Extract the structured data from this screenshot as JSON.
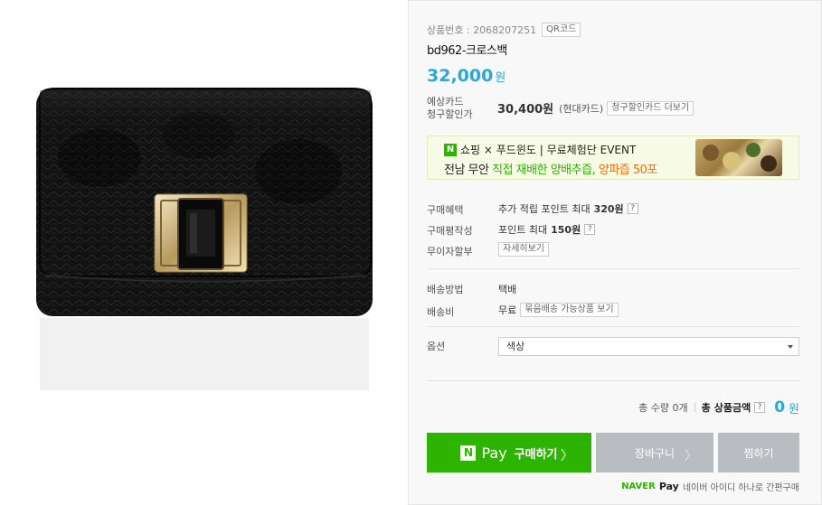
{
  "product": {
    "number_label": "상품번호 : 2068207251",
    "qr_label": "QR코드",
    "name": "bd962-크로스백",
    "price": "32,000",
    "price_unit": "원"
  },
  "card": {
    "label": "예상카드\n청구할인가",
    "price": "30,400원",
    "card_name": "(현대카드)",
    "more_label": "청구할인카드 더보기"
  },
  "banner": {
    "line1": "쇼핑 × 푸드윈도 | 무료체험단 EVENT",
    "line2_a": "전남 무안",
    "line2_b": "직접 재배한 양배추즙,",
    "line2_c": "양파즙 50포"
  },
  "benefits": {
    "purchase_benefit_label": "구매혜택",
    "purchase_benefit_value_a": "추가 적립 포인트 최대",
    "purchase_benefit_value_b": "320원",
    "review_label": "구매평작성",
    "review_value_a": "포인트 최대",
    "review_value_b": "150원",
    "installment_label": "무이자할부",
    "installment_btn": "자세히보기"
  },
  "shipping": {
    "method_label": "배송방법",
    "method_value": "택배",
    "fee_label": "배송비",
    "fee_value": "무료",
    "bundle_btn": "묶음배송 가능상품 보기"
  },
  "option": {
    "label": "옵션",
    "select_value": "색상"
  },
  "total": {
    "qty_label": "총 수량 0개",
    "total_prefix": "총",
    "total_label": "상품금액",
    "amount": "0",
    "amount_unit": "원"
  },
  "buttons": {
    "pay_n": "N",
    "pay": "Pay",
    "buy": "구매하기",
    "cart": "장바구니",
    "wish": "찜하기"
  },
  "footer": {
    "naver": "NAVER",
    "pay": "Pay",
    "text": "네이버 아이디 하나로 간편구매"
  },
  "help_mark": "?",
  "colors": {
    "accent_blue": "#2aa8d8",
    "naver_green": "#2db400",
    "gray_button": "#b9bcc1"
  }
}
